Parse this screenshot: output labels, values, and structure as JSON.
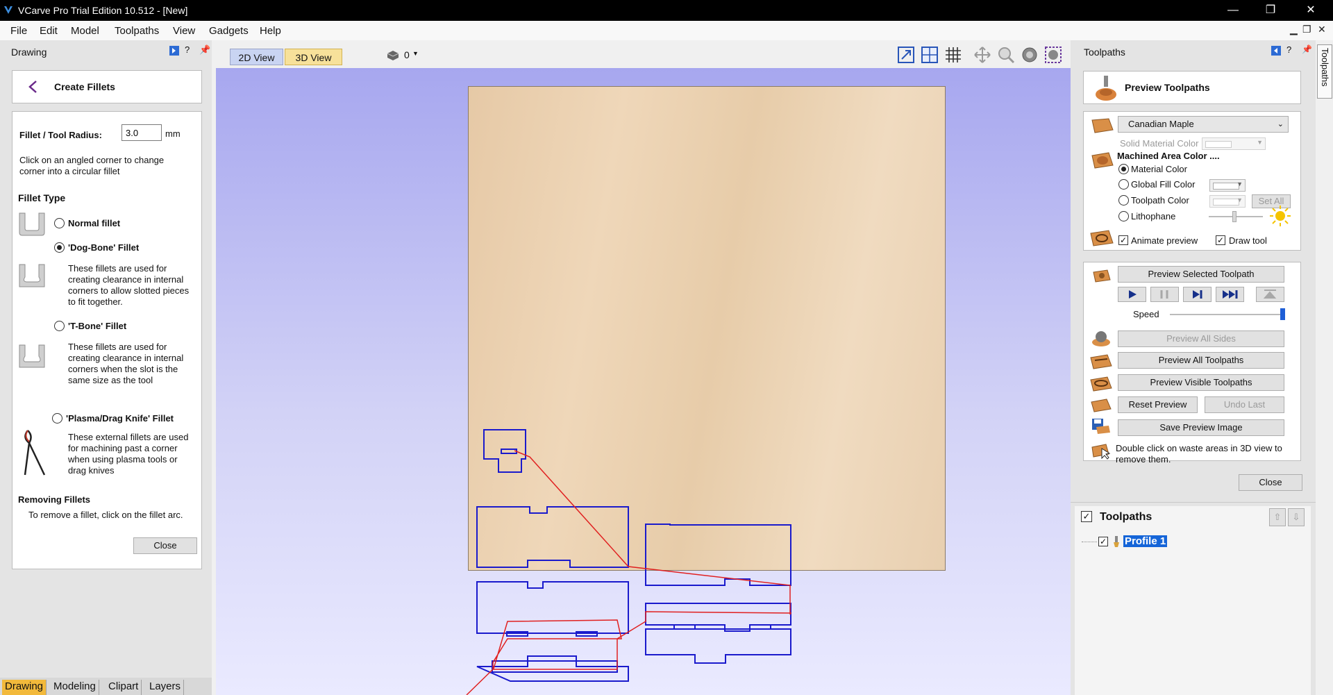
{
  "window": {
    "title": "VCarve Pro Trial Edition 10.512 - [New]",
    "minimize": "—",
    "restore": "❐",
    "close": "✕"
  },
  "menu": [
    "File",
    "Edit",
    "Model",
    "Toolpaths",
    "View",
    "Gadgets",
    "Help"
  ],
  "mdi_controls": [
    "▁",
    "❐",
    "✕"
  ],
  "left_panel": {
    "header": "Drawing",
    "form_title": "Create Fillets",
    "radius_label": "Fillet / Tool Radius:",
    "radius_value": "3.0",
    "radius_unit": "mm",
    "instruction": "Click on an angled corner to change corner into a circular fillet",
    "fillet_type_heading": "Fillet Type",
    "options": [
      {
        "label": "Normal fillet",
        "selected": false,
        "description": ""
      },
      {
        "label": "'Dog-Bone' Fillet",
        "selected": true,
        "description": "These fillets are used for creating clearance in internal corners to allow slotted pieces to fit together."
      },
      {
        "label": "'T-Bone' Fillet",
        "selected": false,
        "description": "These fillets are used for creating clearance in internal corners when the slot is the same size as the tool"
      },
      {
        "label": "'Plasma/Drag Knife' Fillet",
        "selected": false,
        "description": "These external fillets are used for machining past a corner when using plasma tools or drag knives"
      }
    ],
    "removing_heading": "Removing Fillets",
    "removing_text": "To remove a fillet, click on the fillet arc.",
    "close_label": "Close",
    "bottom_tabs": [
      "Drawing",
      "Modeling",
      "Clipart",
      "Layers"
    ],
    "active_tab": "Drawing"
  },
  "view_tabs": {
    "tabs": [
      "2D View",
      "3D View"
    ],
    "active": "3D View",
    "layer_count": "0"
  },
  "right_panel": {
    "header": "Toolpaths",
    "side_tab": "Toolpaths",
    "preview_title": "Preview Toolpaths",
    "material": "Canadian Maple",
    "solid_material_color": "Solid Material Color",
    "machined_area_heading": "Machined Area Color ....",
    "color_options": [
      {
        "label": "Material Color",
        "selected": true
      },
      {
        "label": "Global Fill Color",
        "selected": false
      },
      {
        "label": "Toolpath Color",
        "selected": false
      },
      {
        "label": "Lithophane",
        "selected": false
      }
    ],
    "set_all": "Set All",
    "animate_preview": "Animate preview",
    "draw_tool": "Draw tool",
    "animate_checked": true,
    "draw_tool_checked": true,
    "preview_selected": "Preview Selected Toolpath",
    "speed_label": "Speed",
    "speed_level": 1.0,
    "preview_all_sides": "Preview All Sides",
    "preview_all_toolpaths": "Preview All Toolpaths",
    "preview_visible": "Preview Visible Toolpaths",
    "reset_preview": "Reset Preview",
    "undo_last": "Undo Last",
    "save_preview_image": "Save Preview Image",
    "hint": "Double click on waste areas in 3D view to remove them.",
    "close_label": "Close",
    "toolpaths_heading": "Toolpaths",
    "toolpath_items": [
      {
        "name": "Profile 1",
        "checked": true
      }
    ]
  },
  "colors": {
    "accent": "#f2b93b",
    "toolpath_blue": "#1a1acc",
    "toolpath_red": "#e02020",
    "selection_blue": "#1565d8"
  }
}
